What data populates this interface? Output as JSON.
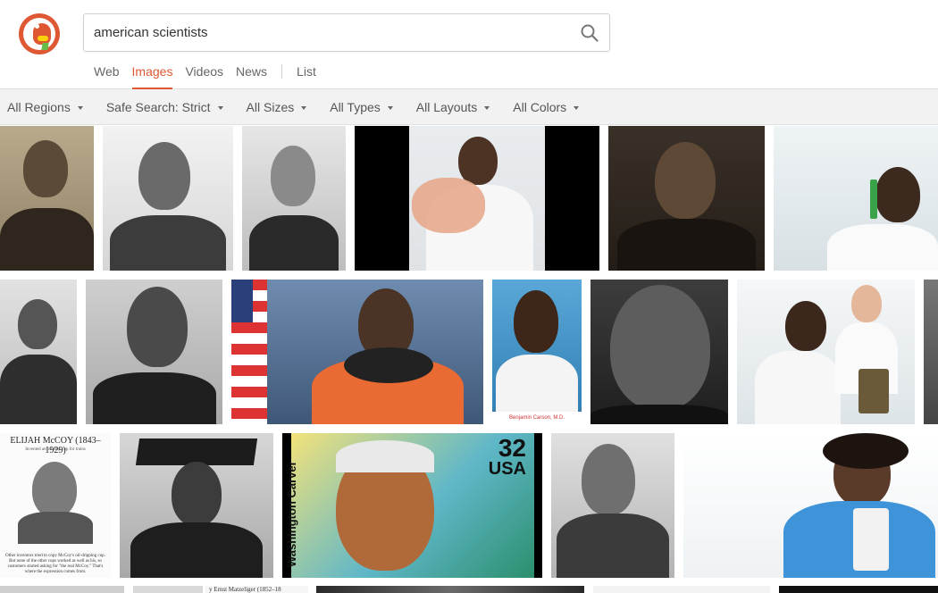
{
  "search": {
    "query": "american scientists"
  },
  "nav": {
    "items": [
      {
        "label": "Web",
        "active": false
      },
      {
        "label": "Images",
        "active": true
      },
      {
        "label": "Videos",
        "active": false
      },
      {
        "label": "News",
        "active": false
      }
    ],
    "list_label": "List"
  },
  "filters": [
    {
      "label": "All Regions"
    },
    {
      "label": "Safe Search: Strict"
    },
    {
      "label": "All Sizes"
    },
    {
      "label": "All Types"
    },
    {
      "label": "All Layouts"
    },
    {
      "label": "All Colors"
    }
  ],
  "image_captions": {
    "carson_photo": "Benjamin Carson, M.D.",
    "mccoy_title": "ELIJAH McCOY (1843–1929)",
    "mccoy_subtitle": "Invented an oil-drip cup for trains",
    "mccoy_footer": "Other inventors tried to copy McCoy's oil-dripping cup. But none of the other cups worked as well as his, so customers started asking for \"the real McCoy.\" That's where the expression comes from.",
    "stamp_value": "32",
    "stamp_country": "USA",
    "stamp_name": "Washington Carver",
    "row4_caption": "y Ernst Matzeliger (1852–18"
  },
  "colors": {
    "accent": "#de5833",
    "nav_inactive": "#666666",
    "filterbar_bg": "#f2f2f2"
  }
}
